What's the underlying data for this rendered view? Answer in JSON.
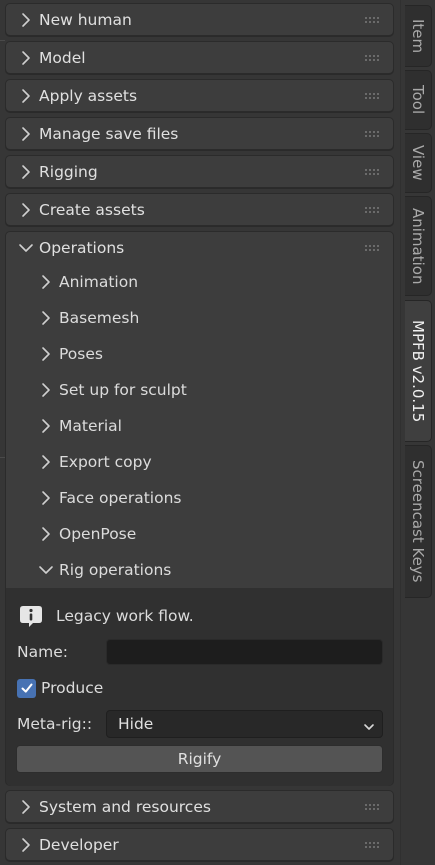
{
  "panels": {
    "new_human": "New human",
    "model": "Model",
    "apply_assets": "Apply assets",
    "manage_save_files": "Manage save files",
    "rigging": "Rigging",
    "create_assets": "Create assets",
    "operations": "Operations",
    "system_and_resources": "System and resources",
    "developer": "Developer"
  },
  "operations": {
    "subpanels": {
      "animation": "Animation",
      "basemesh": "Basemesh",
      "poses": "Poses",
      "set_up_for_sculpt": "Set up for sculpt",
      "material": "Material",
      "export_copy": "Export copy",
      "face_operations": "Face operations",
      "openpose": "OpenPose",
      "rig_operations": "Rig operations"
    },
    "rig_operations": {
      "info_text": "Legacy work flow.",
      "name_label": "Name:",
      "name_value": "",
      "produce_label": "Produce",
      "produce_checked": true,
      "metarig_label": "Meta-rig::",
      "metarig_value": "Hide",
      "rigify_button": "Rigify"
    }
  },
  "tabs": {
    "item": "Item",
    "tool": "Tool",
    "view": "View",
    "animation": "Animation",
    "mpfb": "MPFB v2.0.15",
    "screencast_keys": "Screencast Keys"
  },
  "colors": {
    "panel_bg": "#3d3d3d",
    "subpanel_body_bg": "#303030",
    "checkbox_accent": "#4772b3",
    "active_tab_bg": "#3f3f3f"
  }
}
